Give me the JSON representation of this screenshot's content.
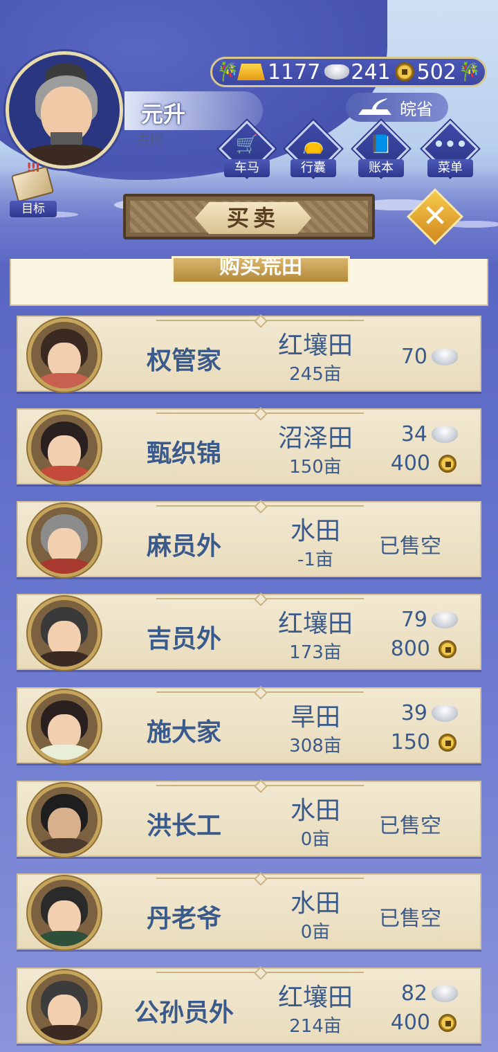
{
  "player": {
    "name": "元升",
    "age_label": "古稀"
  },
  "currency": {
    "gold": "1177",
    "silver": "241",
    "copper": "502"
  },
  "location": "皖省",
  "menu": [
    {
      "label": "车马",
      "icon": "carriage-icon"
    },
    {
      "label": "行囊",
      "icon": "bag-icon"
    },
    {
      "label": "账本",
      "icon": "ledger-icon"
    },
    {
      "label": "菜单",
      "icon": "more-icon"
    }
  ],
  "goal_label": "目标",
  "title": "买卖",
  "section_button": "购买荒田",
  "rows": [
    {
      "name": "权管家",
      "land": "红壤田",
      "area": "245亩",
      "silver": "70",
      "copper": "",
      "sold_out": ""
    },
    {
      "name": "甄织锦",
      "land": "沼泽田",
      "area": "150亩",
      "silver": "34",
      "copper": "400",
      "sold_out": ""
    },
    {
      "name": "麻员外",
      "land": "水田",
      "area": "-1亩",
      "silver": "",
      "copper": "",
      "sold_out": "已售空"
    },
    {
      "name": "吉员外",
      "land": "红壤田",
      "area": "173亩",
      "silver": "79",
      "copper": "800",
      "sold_out": ""
    },
    {
      "name": "施大家",
      "land": "旱田",
      "area": "308亩",
      "silver": "39",
      "copper": "150",
      "sold_out": ""
    },
    {
      "name": "洪长工",
      "land": "水田",
      "area": "0亩",
      "silver": "",
      "copper": "",
      "sold_out": "已售空"
    },
    {
      "name": "丹老爷",
      "land": "水田",
      "area": "0亩",
      "silver": "",
      "copper": "",
      "sold_out": "已售空"
    },
    {
      "name": "公孙员外",
      "land": "红壤田",
      "area": "214亩",
      "silver": "82",
      "copper": "400",
      "sold_out": ""
    }
  ]
}
